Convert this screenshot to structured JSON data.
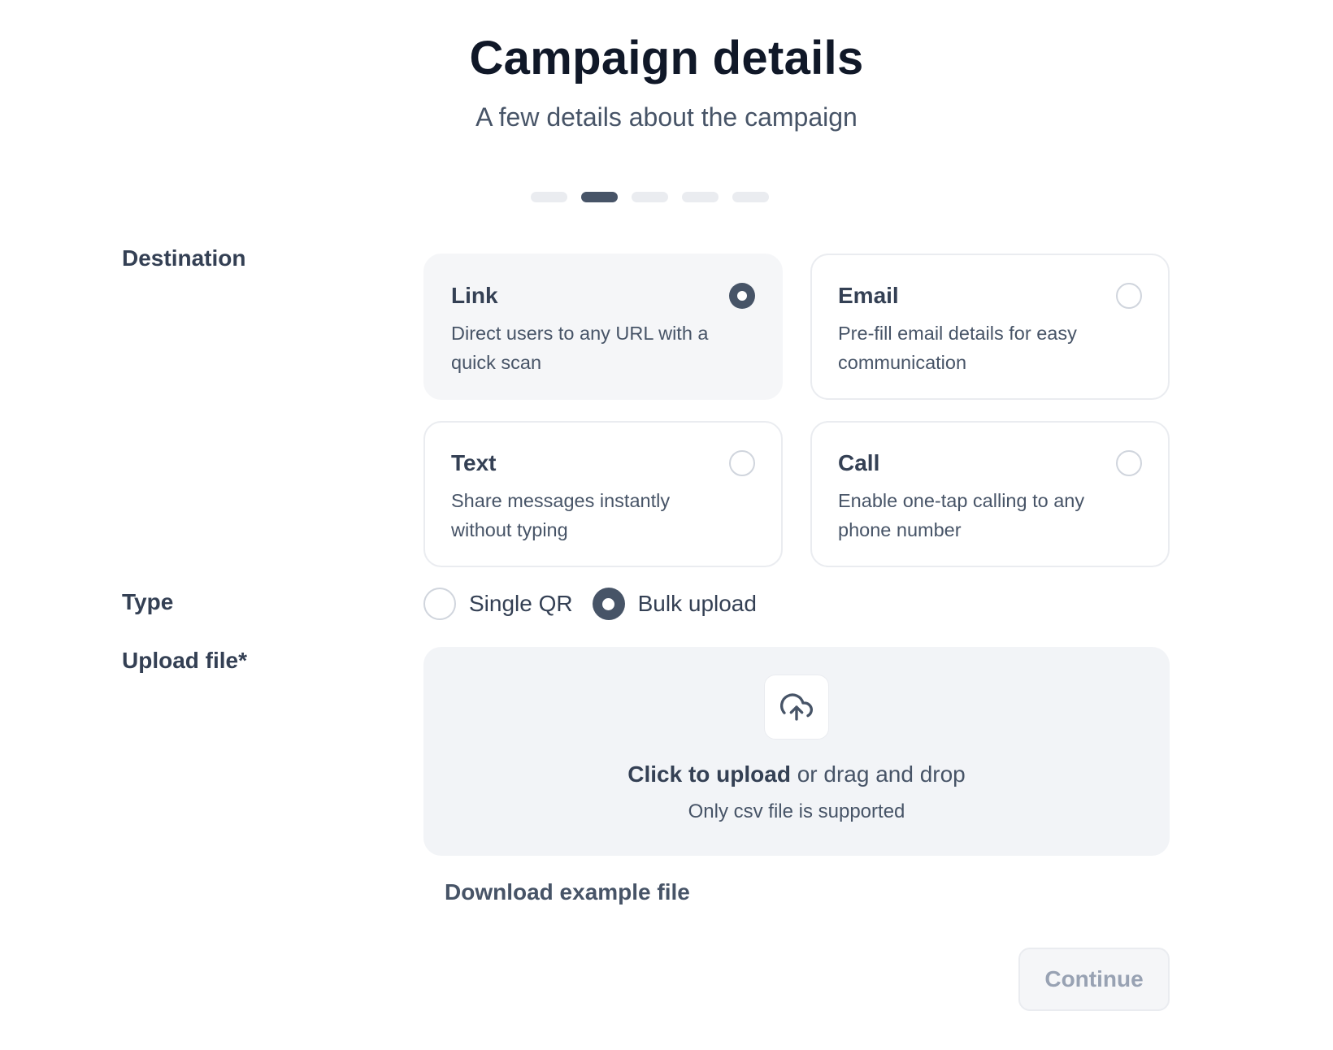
{
  "header": {
    "title": "Campaign details",
    "subtitle": "A few details about the campaign"
  },
  "stepper": {
    "total_steps": 5,
    "current_step": 2
  },
  "destination": {
    "label": "Destination",
    "selected": "Link",
    "options": [
      {
        "title": "Link",
        "description": "Direct users to any URL with a quick scan",
        "checked": true
      },
      {
        "title": "Email",
        "description": "Pre-fill email details for easy communication",
        "checked": false
      },
      {
        "title": "Text",
        "description": "Share messages instantly without typing",
        "checked": false
      },
      {
        "title": "Call",
        "description": "Enable one-tap calling to any phone number",
        "checked": false
      }
    ]
  },
  "type": {
    "label": "Type",
    "options": [
      {
        "label": "Single QR",
        "checked": false
      },
      {
        "label": "Bulk upload",
        "checked": true
      }
    ]
  },
  "upload": {
    "label": "Upload file*",
    "icon": "upload-cloud-icon",
    "cta_bold": "Click to upload",
    "cta_rest": " or drag and drop",
    "hint": "Only csv file is supported",
    "download_link": "Download example file"
  },
  "actions": {
    "continue_label": "Continue",
    "continue_disabled": true
  },
  "colors": {
    "primary_dark": "#475467",
    "title_text": "#101828",
    "muted_text": "#475467",
    "border": "#eaecf0",
    "upload_bg": "#f2f4f7",
    "disabled_text": "#98a2b3"
  }
}
